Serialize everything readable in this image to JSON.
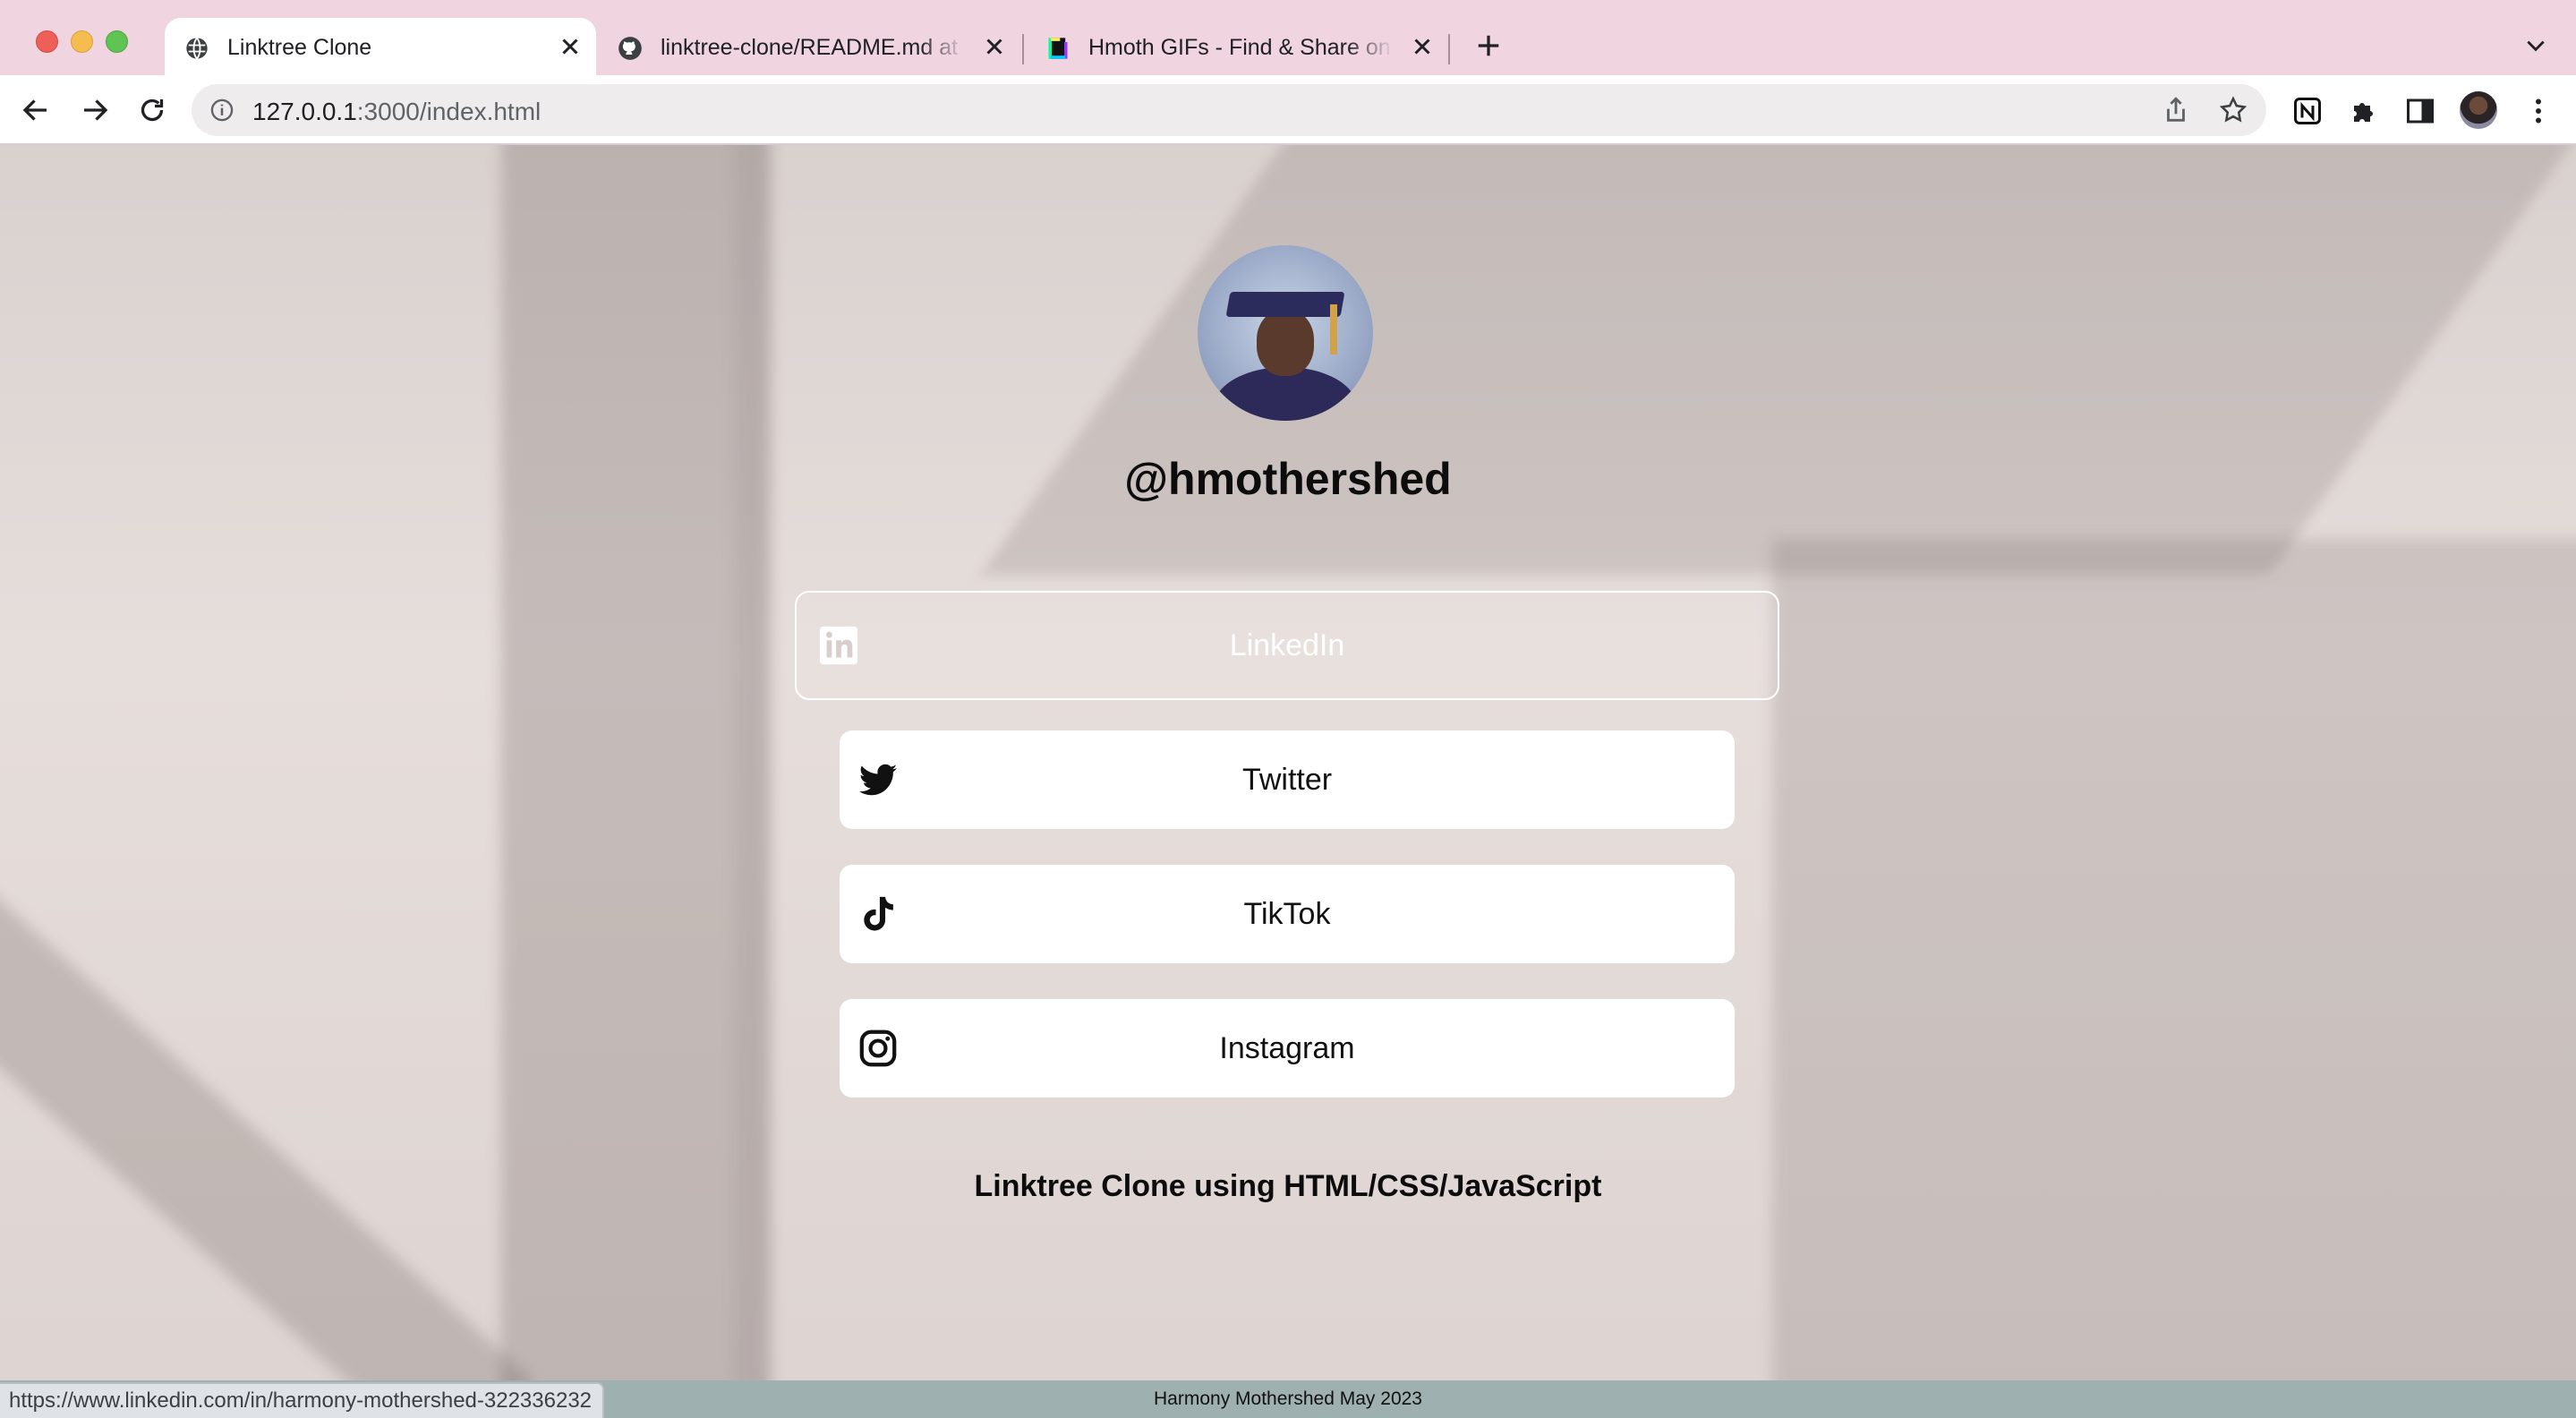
{
  "browser": {
    "tabs": [
      {
        "title": "Linktree Clone",
        "icon": "globe-icon",
        "active": true
      },
      {
        "title": "linktree-clone/README.md at m",
        "icon": "github-icon",
        "active": false
      },
      {
        "title": "Hmoth GIFs - Find & Share on G",
        "icon": "giphy-icon",
        "active": false
      }
    ],
    "address": {
      "host": "127.0.0.1",
      "path": ":3000/index.html"
    },
    "status_url": "https://www.linkedin.com/in/harmony-mothershed-322336232"
  },
  "page": {
    "handle": "@hmothershed",
    "links": [
      {
        "label": "LinkedIn",
        "icon": "linkedin-icon"
      },
      {
        "label": "Twitter",
        "icon": "twitter-icon"
      },
      {
        "label": "TikTok",
        "icon": "tiktok-icon"
      },
      {
        "label": "Instagram",
        "icon": "instagram-icon"
      }
    ],
    "tagline": "Linktree Clone using HTML/CSS/JavaScript",
    "footer": "Harmony Mothershed May 2023"
  },
  "colors": {
    "tabstrip": "#f0d4e0",
    "footer_bg": "#9fb0b0",
    "button_bg": "#ffffff"
  }
}
